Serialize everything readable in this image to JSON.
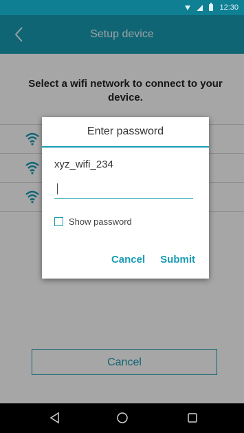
{
  "status_bar": {
    "time": "12:30"
  },
  "app_bar": {
    "title": "Setup device"
  },
  "content": {
    "instruction": "Select a wifi network to connect to your device.",
    "wifi_networks": [
      {
        "name": ""
      },
      {
        "name": ""
      },
      {
        "name": ""
      }
    ],
    "cancel_label": "Cancel"
  },
  "dialog": {
    "title": "Enter password",
    "ssid": "xyz_wifi_234",
    "password_value": "",
    "show_password_label": "Show password",
    "show_password_checked": false,
    "cancel_label": "Cancel",
    "submit_label": "Submit"
  },
  "icons": {
    "status": [
      "wifi-signal-icon",
      "cell-signal-icon",
      "battery-icon"
    ],
    "app_bar": "back-arrow-icon",
    "wifi_row": "wifi-icon",
    "nav": [
      "back-triangle-icon",
      "home-circle-icon",
      "recents-square-icon"
    ]
  },
  "colors": {
    "primary": "#1a9bb3",
    "status_bar": "#0f7f93",
    "nav_bar": "#000000"
  }
}
